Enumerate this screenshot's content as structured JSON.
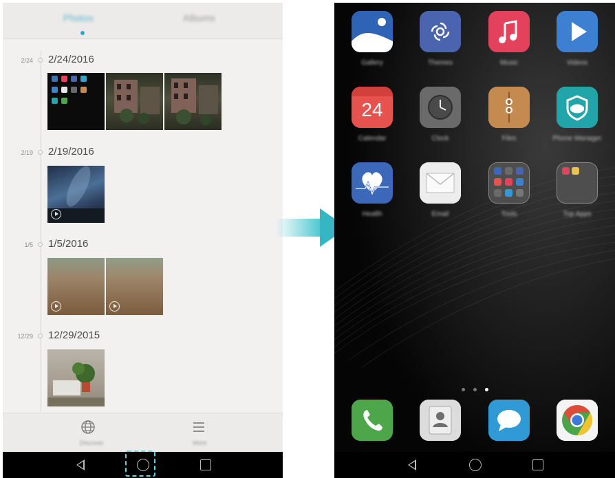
{
  "gallery": {
    "tabs": [
      {
        "label": "Photos",
        "active": true
      },
      {
        "label": "Albums",
        "active": false
      }
    ],
    "sections": [
      {
        "short_date": "2/24",
        "date": "2/24/2016",
        "thumb_count": 3
      },
      {
        "short_date": "2/19",
        "date": "2/19/2016",
        "thumb_count": 1
      },
      {
        "short_date": "1/5",
        "date": "1/5/2016",
        "thumb_count": 2
      },
      {
        "short_date": "12/29",
        "date": "12/29/2015",
        "thumb_count": 1
      }
    ],
    "bottom_actions": [
      {
        "label": "Discover",
        "icon": "globe-icon"
      },
      {
        "label": "More",
        "icon": "menu-icon"
      }
    ]
  },
  "home_screen": {
    "apps": [
      {
        "label": "Gallery",
        "icon": "gallery-icon",
        "color": "#3f6fb8"
      },
      {
        "label": "Themes",
        "icon": "themes-icon",
        "color": "#4a64b0"
      },
      {
        "label": "Music",
        "icon": "music-icon",
        "color": "#e4415c"
      },
      {
        "label": "Videos",
        "icon": "videos-icon",
        "color": "#3d7fd0"
      },
      {
        "label": "Calendar",
        "icon": "calendar-icon",
        "color": "#e6524d",
        "day": "24"
      },
      {
        "label": "Clock",
        "icon": "clock-icon",
        "color": "#6a6a6a"
      },
      {
        "label": "Files",
        "icon": "files-icon",
        "color": "#c48a4f"
      },
      {
        "label": "Phone Manager",
        "icon": "shield-icon",
        "color": "#22a5a9"
      },
      {
        "label": "Health",
        "icon": "health-icon",
        "color": "#3b68b8"
      },
      {
        "label": "Email",
        "icon": "email-icon",
        "color": "#e6e6e6"
      },
      {
        "label": "Tools",
        "icon": "folder-icon",
        "color": "#5a5a5a"
      },
      {
        "label": "Top Apps",
        "icon": "folder-icon",
        "color": "#5a5a5a"
      }
    ],
    "page_indicator": {
      "pages": 3,
      "current": 3
    },
    "dock": [
      {
        "name": "phone",
        "icon": "phone-icon",
        "color": "#4ea64a"
      },
      {
        "name": "contacts",
        "icon": "contacts-icon",
        "color": "#d7d7d7"
      },
      {
        "name": "messaging",
        "icon": "messaging-icon",
        "color": "#2f9ad6"
      },
      {
        "name": "chrome",
        "icon": "chrome-icon",
        "color": "#dd4b39"
      }
    ]
  },
  "navigation": {
    "buttons": [
      "back-icon",
      "home-icon",
      "recents-icon"
    ]
  },
  "colors": {
    "accent": "#2aa7c9",
    "arrow": "#35b7c3"
  }
}
